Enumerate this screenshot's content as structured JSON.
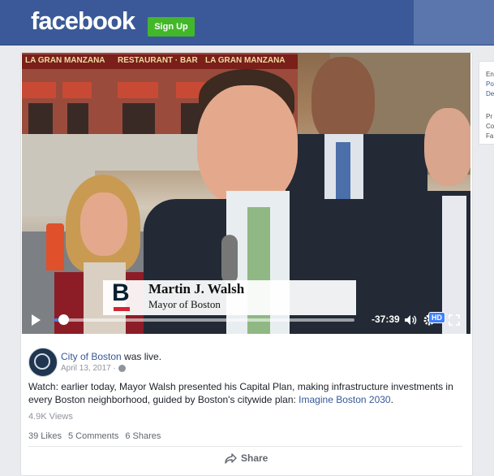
{
  "header": {
    "logo": "facebook",
    "signup_label": "Sign Up"
  },
  "side_panel": {
    "lines": [
      "En",
      "Po",
      "De",
      "Pr",
      "Co",
      "Fa"
    ]
  },
  "video": {
    "background_signs": [
      "LA GRAN MANZANA",
      "RESTAURANT · BAR",
      "LA GRAN MANZANA"
    ],
    "lower_third": {
      "logo_letter": "B",
      "name": "Martin J. Walsh",
      "title": "Mayor of Boston"
    },
    "controls": {
      "time_remaining": "-37:39",
      "hd_label": "HD",
      "progress": 0.03
    }
  },
  "post": {
    "page_name": "City of Boston",
    "status": " was live.",
    "date": "April 13, 2017 ·",
    "body": "Watch: earlier today, Mayor Walsh presented his Capital Plan, making infrastructure investments in every Boston neighborhood, guided by Boston's citywide plan: ",
    "body_link": "Imagine Boston 2030",
    "body_end": ".",
    "views": "4.9K Views",
    "likes": "39 Likes",
    "comments": "5 Comments",
    "shares": "6 Shares",
    "share_label": "Share"
  },
  "colors": {
    "brand_blue": "#3b5998",
    "signup_green": "#42b72a",
    "link_blue": "#365899",
    "progress_blue": "#4080ff"
  }
}
